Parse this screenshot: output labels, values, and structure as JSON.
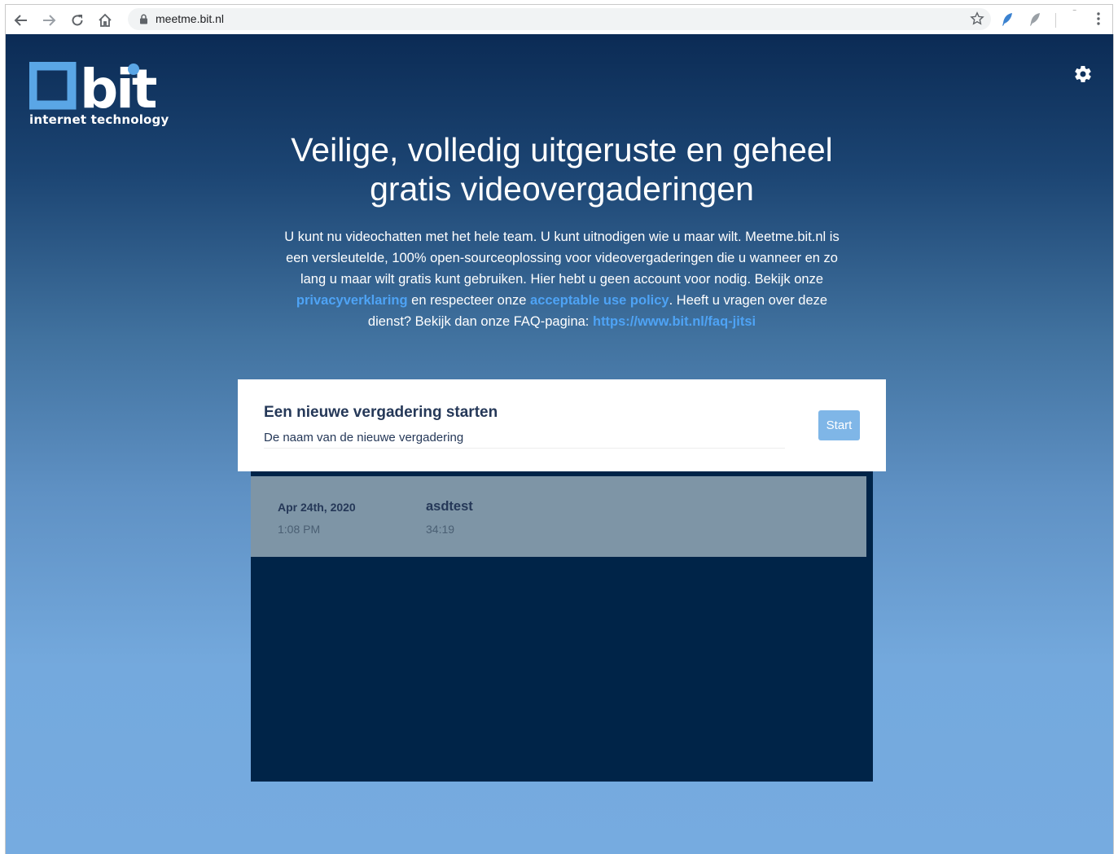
{
  "browser": {
    "url": "meetme.bit.nl"
  },
  "logo": {
    "mark_text": "bit",
    "subtitle": "internet technology"
  },
  "hero": {
    "title": "Veilige, volledig uitgeruste en geheel gratis videovergaderingen",
    "intro_part1": "U kunt nu videochatten met het hele team. U kunt uitnodigen wie u maar wilt. Meetme.bit.nl is een versleutelde, 100% open-sourceoplossing voor videovergaderingen die u wanneer en zo lang u maar wilt gratis kunt gebruiken. Hier hebt u geen account voor nodig. Bekijk onze ",
    "privacy_link": "privacyverklaring",
    "intro_part2": " en respecteer onze ",
    "aup_link": "acceptable use policy",
    "intro_part3": ". Heeft u vragen over deze dienst? Bekijk dan onze FAQ-pagina: ",
    "faq_link": "https://www.bit.nl/faq-jitsi"
  },
  "start": {
    "title": "Een nieuwe vergadering starten",
    "input_value": "De naam van de nieuwe vergadering",
    "button_label": "Start"
  },
  "recent": [
    {
      "date": "Apr 24th, 2020",
      "time": "1:08 PM",
      "name": "asdtest",
      "duration": "34:19"
    }
  ],
  "colors": {
    "accent_link": "#4ea3f5",
    "start_button": "#7fb6e7",
    "recent_panel": "#002448",
    "recent_row": "#7e95a6",
    "logo_blue": "#5aa6e6"
  },
  "icons": [
    "back-arrow-icon",
    "forward-arrow-icon",
    "reload-icon",
    "home-icon",
    "lock-icon",
    "star-icon",
    "feather-extension-icon",
    "gear-icon",
    "kebab-menu-icon"
  ]
}
